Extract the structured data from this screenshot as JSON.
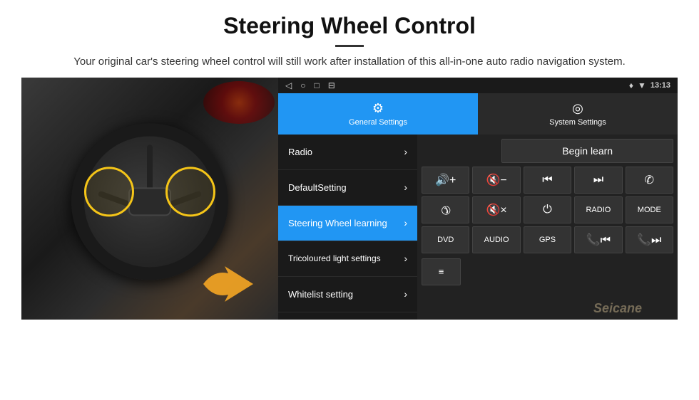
{
  "header": {
    "title": "Steering Wheel Control",
    "subtitle": "Your original car's steering wheel control will still work after installation of this all-in-one auto radio navigation system."
  },
  "status_bar": {
    "nav_back": "◁",
    "nav_home": "○",
    "nav_recent": "□",
    "nav_cast": "⊟",
    "gps_icon": "♦",
    "wifi_icon": "▼",
    "time": "13:13"
  },
  "tabs": [
    {
      "id": "general",
      "label": "General Settings",
      "icon": "⚙",
      "active": true
    },
    {
      "id": "system",
      "label": "System Settings",
      "icon": "◎",
      "active": false
    }
  ],
  "menu": [
    {
      "id": "radio",
      "label": "Radio",
      "active": false
    },
    {
      "id": "default",
      "label": "DefaultSetting",
      "active": false
    },
    {
      "id": "steering",
      "label": "Steering Wheel learning",
      "active": true
    },
    {
      "id": "tricolour",
      "label": "Tricoloured light settings",
      "active": false
    },
    {
      "id": "whitelist",
      "label": "Whitelist setting",
      "active": false
    }
  ],
  "right_panel": {
    "begin_learn_label": "Begin learn",
    "controls": [
      {
        "id": "vol-up",
        "label": "🔊+",
        "sym": "vol+"
      },
      {
        "id": "vol-down",
        "label": "🔇-",
        "sym": "vol-"
      },
      {
        "id": "prev",
        "label": "⏮",
        "sym": "⏮"
      },
      {
        "id": "next",
        "label": "⏭",
        "sym": "⏭"
      },
      {
        "id": "phone",
        "label": "✆",
        "sym": "✆"
      },
      {
        "id": "call-end",
        "label": "☏",
        "sym": "↩"
      },
      {
        "id": "mute",
        "label": "🔇x",
        "sym": "🔇"
      },
      {
        "id": "power",
        "label": "⏻",
        "sym": "⏻"
      },
      {
        "id": "radio-btn",
        "label": "RADIO",
        "sym": "RADIO"
      },
      {
        "id": "mode",
        "label": "MODE",
        "sym": "MODE"
      },
      {
        "id": "dvd",
        "label": "DVD",
        "sym": "DVD"
      },
      {
        "id": "audio",
        "label": "AUDIO",
        "sym": "AUDIO"
      },
      {
        "id": "gps",
        "label": "GPS",
        "sym": "GPS"
      },
      {
        "id": "prev2",
        "label": "⏮",
        "sym": "⏮"
      },
      {
        "id": "next2",
        "label": "⏭",
        "sym": "⏭"
      }
    ],
    "last_row_icon": "≡"
  },
  "watermark": "Seicane"
}
